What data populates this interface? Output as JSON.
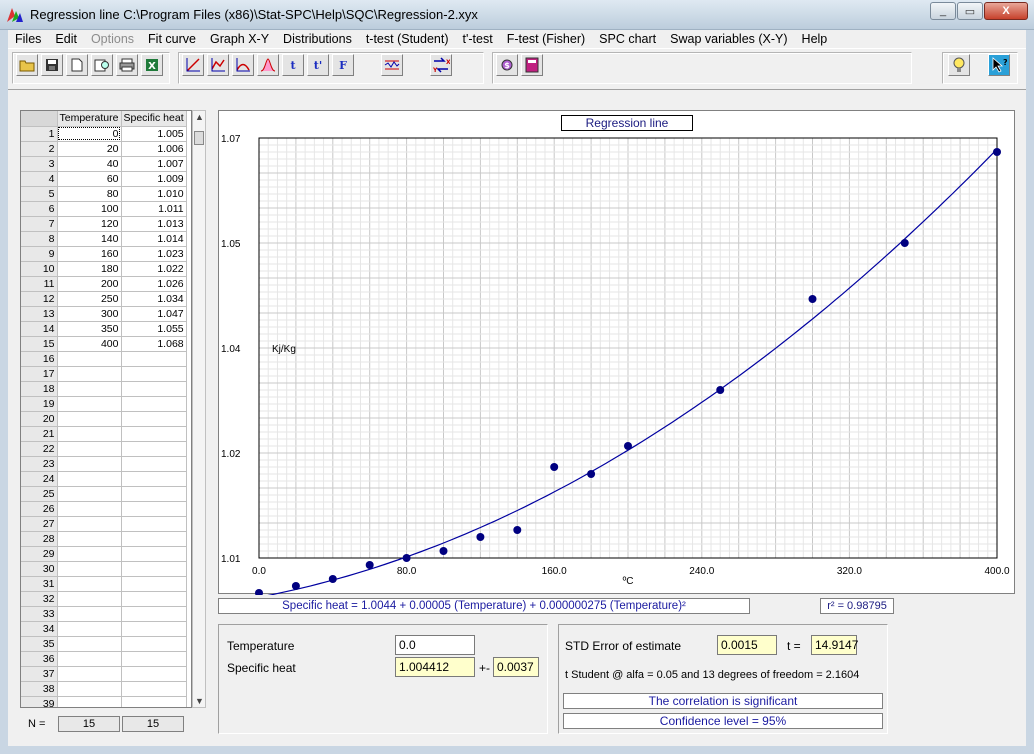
{
  "window": {
    "title": "Regression line   C:\\Program Files (x86)\\Stat-SPC\\Help\\SQC\\Regression-2.xyx",
    "minimize": "_",
    "restore": "▭",
    "close": "X"
  },
  "menu": [
    "Files",
    "Edit",
    "Options",
    "Fit curve",
    "Graph X-Y",
    "Distributions",
    "t-test (Student)",
    "t'-test",
    "F-test (Fisher)",
    "SPC chart",
    "Swap variables (X-Y)",
    "Help"
  ],
  "toolbar": {
    "t_label": "t",
    "tprime_label": "t'",
    "f_label": "F"
  },
  "grid": {
    "col1_header": "Temperature",
    "col2_header": "Specific heat",
    "rows": [
      [
        "1",
        "0",
        "1.005"
      ],
      [
        "2",
        "20",
        "1.006"
      ],
      [
        "3",
        "40",
        "1.007"
      ],
      [
        "4",
        "60",
        "1.009"
      ],
      [
        "5",
        "80",
        "1.010"
      ],
      [
        "6",
        "100",
        "1.011"
      ],
      [
        "7",
        "120",
        "1.013"
      ],
      [
        "8",
        "140",
        "1.014"
      ],
      [
        "9",
        "160",
        "1.023"
      ],
      [
        "10",
        "180",
        "1.022"
      ],
      [
        "11",
        "200",
        "1.026"
      ],
      [
        "12",
        "250",
        "1.034"
      ],
      [
        "13",
        "300",
        "1.047"
      ],
      [
        "14",
        "350",
        "1.055"
      ],
      [
        "15",
        "400",
        "1.068"
      ],
      [
        "16",
        "",
        ""
      ],
      [
        "17",
        "",
        ""
      ],
      [
        "18",
        "",
        ""
      ],
      [
        "19",
        "",
        ""
      ],
      [
        "20",
        "",
        ""
      ],
      [
        "21",
        "",
        ""
      ],
      [
        "22",
        "",
        ""
      ],
      [
        "23",
        "",
        ""
      ],
      [
        "24",
        "",
        ""
      ],
      [
        "25",
        "",
        ""
      ],
      [
        "26",
        "",
        ""
      ],
      [
        "27",
        "",
        ""
      ],
      [
        "28",
        "",
        ""
      ],
      [
        "29",
        "",
        ""
      ],
      [
        "30",
        "",
        ""
      ],
      [
        "31",
        "",
        ""
      ],
      [
        "32",
        "",
        ""
      ],
      [
        "33",
        "",
        ""
      ],
      [
        "34",
        "",
        ""
      ],
      [
        "35",
        "",
        ""
      ],
      [
        "36",
        "",
        ""
      ],
      [
        "37",
        "",
        ""
      ],
      [
        "38",
        "",
        ""
      ],
      [
        "39",
        "",
        ""
      ]
    ],
    "n_label": "N =",
    "n_col1": "15",
    "n_col2": "15"
  },
  "chart_data": {
    "type": "scatter",
    "title": "Regression line",
    "xlabel": "ºC",
    "ylabel": "Kj/Kg",
    "xlim": [
      0,
      400
    ],
    "ylim": [
      1.01,
      1.07
    ],
    "x_ticks": [
      "0.0",
      "80.0",
      "160.0",
      "240.0",
      "320.0",
      "400.0"
    ],
    "y_ticks": [
      "1.01",
      "1.02",
      "1.04",
      "1.05",
      "1.07"
    ],
    "y_tick_values": [
      1.0,
      1.02,
      1.04,
      1.05,
      1.07
    ],
    "grid": true,
    "points": {
      "x": [
        0,
        20,
        40,
        60,
        80,
        100,
        120,
        140,
        160,
        180,
        200,
        250,
        300,
        350,
        400
      ],
      "y": [
        1.005,
        1.006,
        1.007,
        1.009,
        1.01,
        1.011,
        1.013,
        1.014,
        1.023,
        1.022,
        1.026,
        1.034,
        1.047,
        1.055,
        1.068
      ]
    },
    "fit": {
      "a": 1.0044,
      "b": 5e-05,
      "c": 2.75e-07
    },
    "point_color": "#000080",
    "line_color": "#0000a0"
  },
  "equation": "Specific heat = 1.0044 + 0.00005 (Temperature) + 0.000000275 (Temperature)²",
  "r2": "r² = 0.98795",
  "predict": {
    "x_label": "Temperature",
    "x_value": "0.0",
    "y_label": "Specific heat",
    "y_value": "1.004412",
    "pm_label": "+-",
    "pm_value": "0.0037"
  },
  "stats": {
    "std_error_label": "STD Error of estimate",
    "std_error_value": "0.0015",
    "t_label": "t =",
    "t_value": "14.9147",
    "t_student_text": "t Student @ alfa = 0.05 and 13 degrees of freedom = 2.1604",
    "correlation_text": "The correlation is significant",
    "confidence_text": "Confidence level = 95%"
  }
}
